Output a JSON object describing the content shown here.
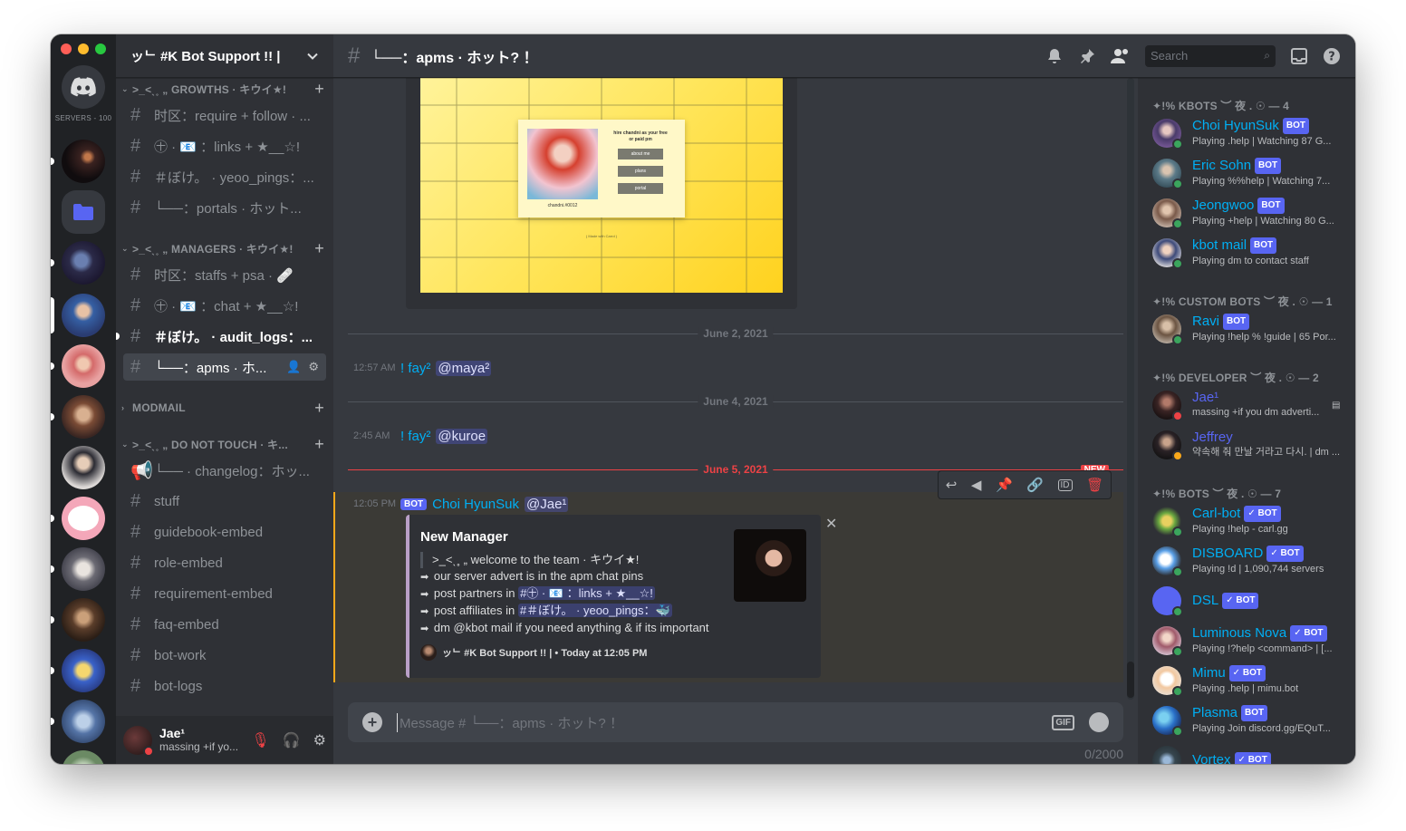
{
  "app": {
    "servers_label": "SERVERS - 100"
  },
  "guild": {
    "name": "ッᄂ #K Bot Support !! |"
  },
  "categories": [
    {
      "label": ">_<ˎ˳ „ GROWTHS · キウイ★!"
    },
    {
      "label": ">_<ˎ˳ „ MANAGERS · キウイ★!"
    },
    {
      "label": "MODMAIL"
    },
    {
      "label": ">_<ˎ˳ „ DO NOT TOUCH · キ..."
    }
  ],
  "channels": {
    "growths": [
      {
        "name": "时区：require + follow · ..."
      },
      {
        "name": "㊉ · 📧 ：links + ★__☆!"
      },
      {
        "name": "＃ぼけ。 · yeoo_pings：..."
      },
      {
        "name": "└──：portals · ホット..."
      }
    ],
    "managers": [
      {
        "name": "时区：staffs + psa · 🩹"
      },
      {
        "name": "㊉ · 📧 ：chat + ★__☆!"
      },
      {
        "name": "＃ぼけ。 · audit_logs：..."
      },
      {
        "name": "└──：apms · ホ..."
      }
    ],
    "donottouch": [
      {
        "name": "└── · changelog：ホッ..."
      },
      {
        "name": "stuff"
      },
      {
        "name": "guidebook-embed"
      },
      {
        "name": "role-embed"
      },
      {
        "name": "requirement-embed"
      },
      {
        "name": "faq-embed"
      },
      {
        "name": "bot-work"
      },
      {
        "name": "bot-logs"
      }
    ]
  },
  "user": {
    "name": "Jae¹",
    "status": "massing +if yo..."
  },
  "header": {
    "channel_title": "└──：apms · ホット? ！",
    "search_placeholder": "Search"
  },
  "preview": {
    "about": "about me",
    "plans": "plans",
    "portal": "portal",
    "heading": "hire chandni as your free or paid pm",
    "caption": "chandni.#0012",
    "footer": "( Made with Carrd )"
  },
  "dividers": [
    "June 2, 2021",
    "June 4, 2021",
    "June 5, 2021"
  ],
  "new_label": "NEW",
  "messages": [
    {
      "time": "12:57 AM",
      "cmd": "! fay²",
      "mention": "@maya²"
    },
    {
      "time": "2:45 AM",
      "cmd": "! fay²",
      "mention": "@kuroe"
    }
  ],
  "bot_message": {
    "time": "12:05 PM",
    "badge": "BOT",
    "author": "Choi HyunSuk",
    "mention": "@Jae¹",
    "embed": {
      "title": "New Manager",
      "line1": ">_<ˎ˳ „ welcome to the team · キウイ★!",
      "line2": "our server advert is in the apm chat pins",
      "line3_pre": "post partners in",
      "line3_ch": "#㊉ · 📧 ：links + ★__☆!",
      "line4_pre": "post affiliates in",
      "line4_ch": "#＃ぼけ。 · yeoo_pings：🐳",
      "line5": "dm @kbot mail if you need anything & if its important",
      "footer": "ッᄂ #K Bot Support !! | • Today at 12:05 PM"
    }
  },
  "composer": {
    "placeholder": "Message # └──：apms · ホット? ！",
    "gif": "GIF",
    "counter": "0/2000"
  },
  "member_groups": [
    {
      "label": "✦!% KBOTS ︶ 夜 . ☉ — 4"
    },
    {
      "label": "✦!% CUSTOM BOTS ︶ 夜 . ☉ — 1"
    },
    {
      "label": "✦!% DEVELOPER ︶ 夜 . ☉ — 2"
    },
    {
      "label": "✦!% BOTS ︶ 夜 . ☉ — 7"
    }
  ],
  "members": [
    {
      "name": "Choi HyunSuk",
      "badge": "BOT",
      "activity": "Playing .help | Watching 87 G..."
    },
    {
      "name": "Eric Sohn",
      "badge": "BOT",
      "activity": "Playing %%help | Watching 7..."
    },
    {
      "name": "Jeongwoo",
      "badge": "BOT",
      "activity": "Playing +help | Watching 80 G..."
    },
    {
      "name": "kbot mail",
      "badge": "BOT",
      "activity": "Playing dm to contact staff"
    },
    {
      "name": "Ravi",
      "badge": "BOT",
      "activity": "Playing !help % !guide | 65 Por..."
    },
    {
      "name": "Jae¹",
      "badge": "",
      "activity": "massing +if you dm adverti..."
    },
    {
      "name": "Jeffrey",
      "badge": "",
      "activity": "약속해 줘 만날 거라고 다시. | dm ..."
    },
    {
      "name": "Carl-bot",
      "badge": "BOT",
      "activity": "Playing !help - carl.gg"
    },
    {
      "name": "DISBOARD",
      "badge": "BOT",
      "activity": "Playing !d | 1,090,744 servers"
    },
    {
      "name": "DSL",
      "badge": "BOT",
      "activity": ""
    },
    {
      "name": "Luminous Nova",
      "badge": "BOT",
      "activity": "Playing !?help <command> | [..."
    },
    {
      "name": "Mimu",
      "badge": "BOT",
      "activity": "Playing .help | mimu.bot"
    },
    {
      "name": "Plasma",
      "badge": "BOT",
      "activity": "Playing Join discord.gg/EQuT..."
    },
    {
      "name": "Vortex",
      "badge": "BOT",
      "activity": ""
    }
  ],
  "colors": {
    "accent": "#5865f2",
    "link": "#00aff4",
    "online": "#3ba55d",
    "dnd": "#ed4245",
    "idle": "#faa81a"
  }
}
